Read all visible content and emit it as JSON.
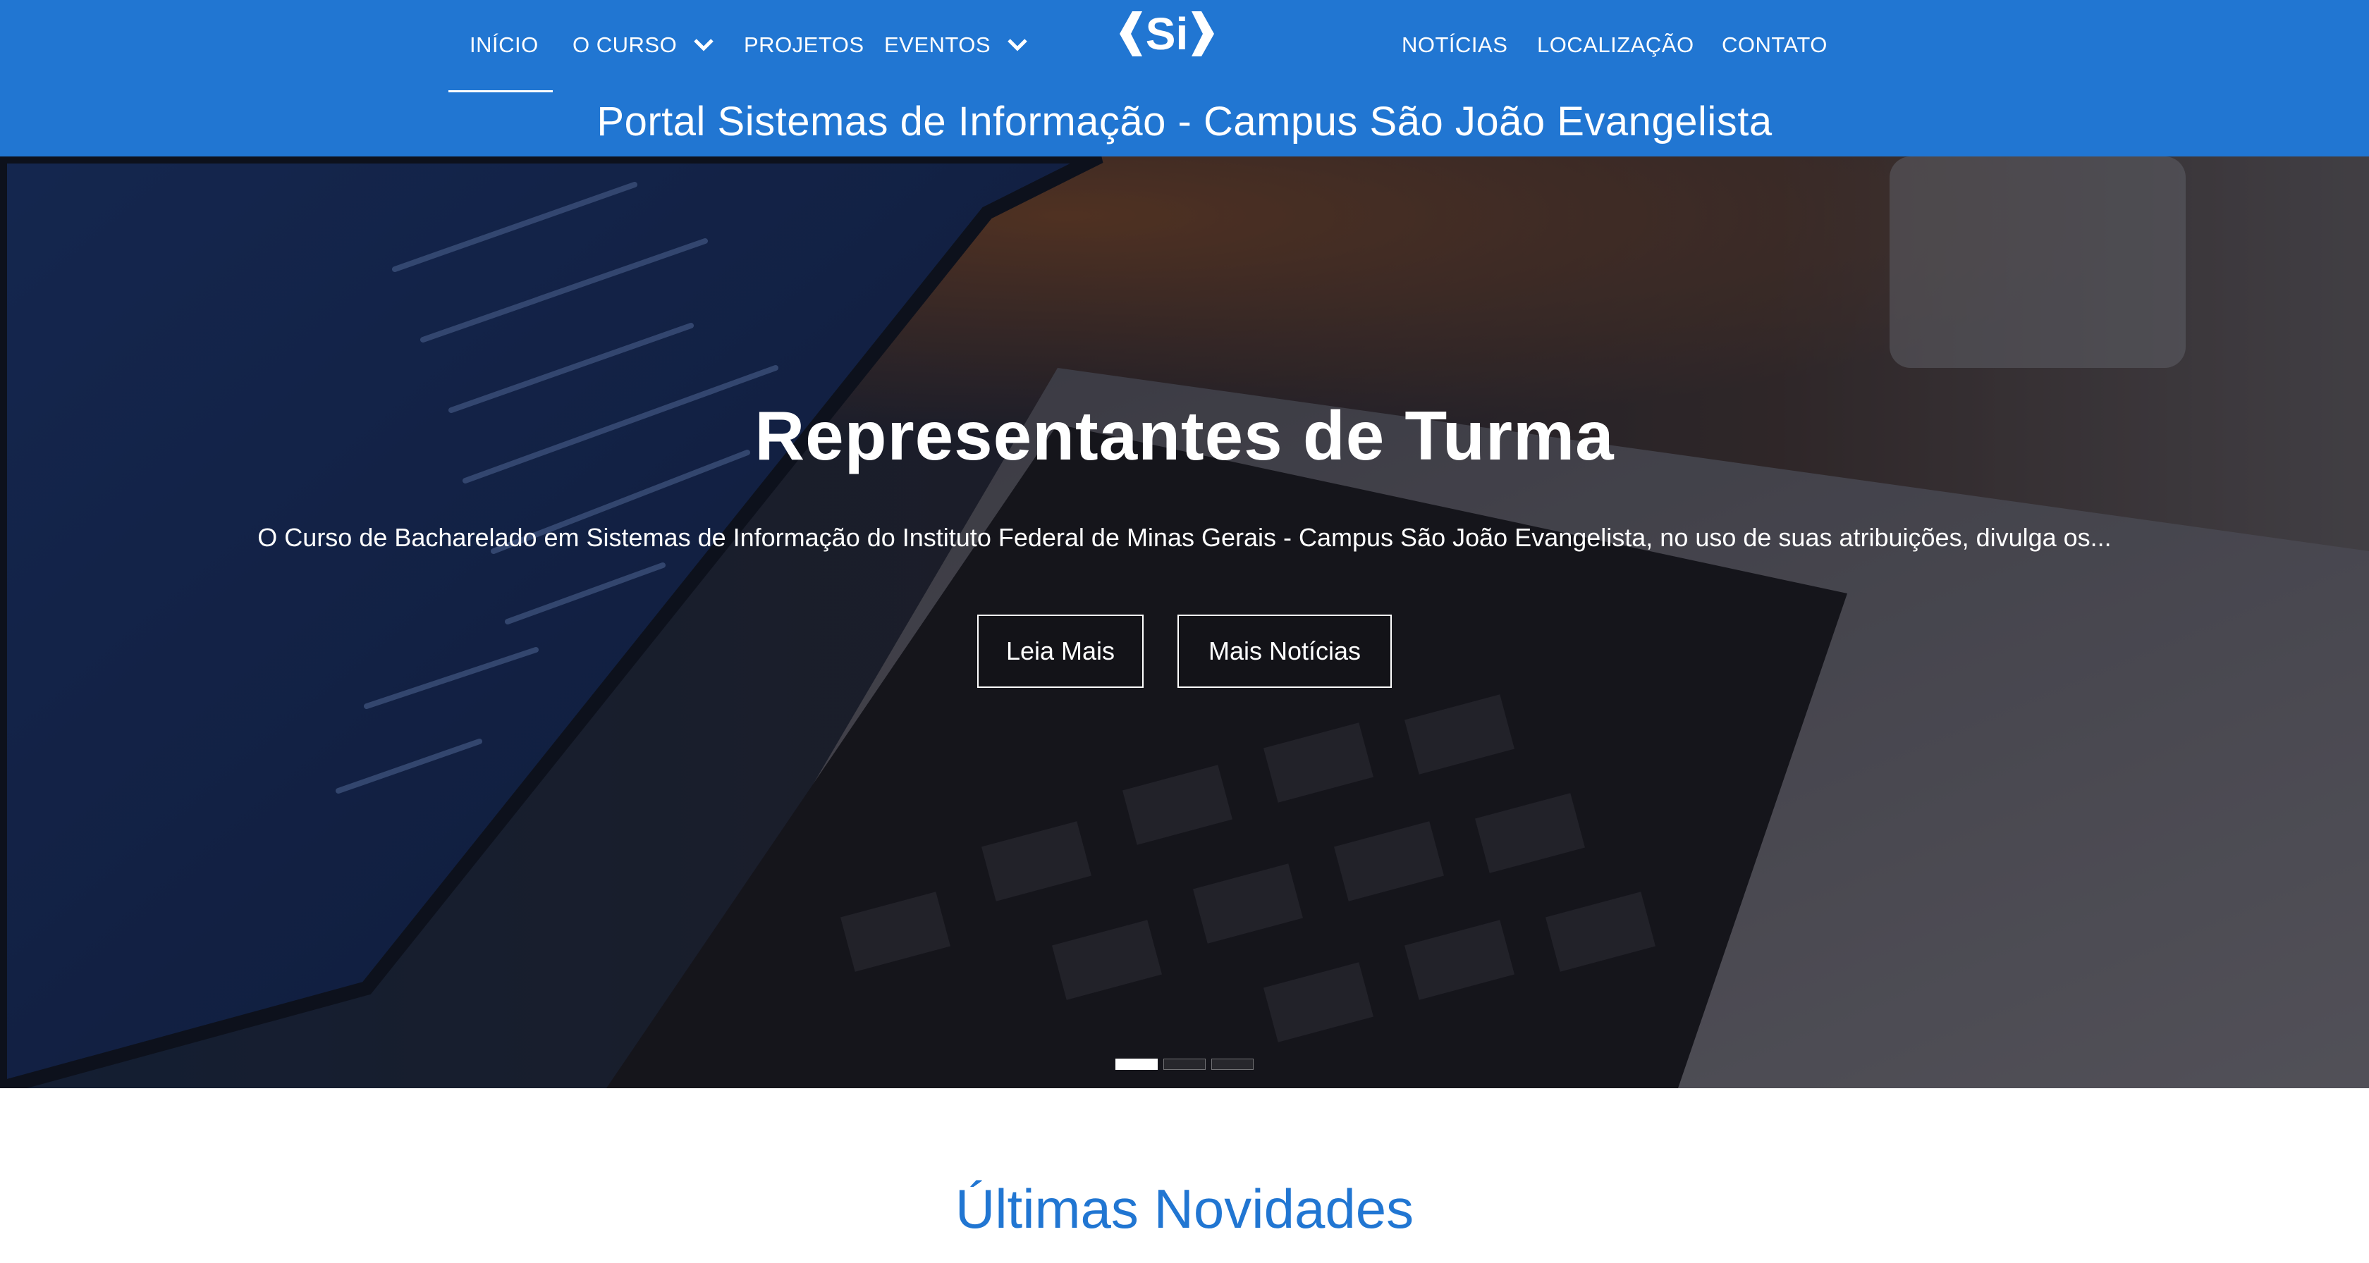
{
  "nav": {
    "left_items": [
      {
        "label": "INÍCIO"
      },
      {
        "label": "O CURSO"
      },
      {
        "label": "PROJETOS"
      },
      {
        "label": "EVENTOS"
      }
    ],
    "right_items": [
      {
        "label": "NOTÍCIAS"
      },
      {
        "label": "LOCALIZAÇÃO"
      },
      {
        "label": "CONTATO"
      }
    ],
    "logo_text": "Si"
  },
  "site_title": "Portal Sistemas de Informação - Campus São João Evangelista",
  "hero": {
    "title": "Representantes de Turma",
    "description": "O Curso de Bacharelado em Sistemas de Informação do Instituto Federal de Minas Gerais - Campus São João Evangelista, no uso de suas atribuições, divulga os...",
    "read_more_label": "Leia Mais",
    "more_news_label": "Mais Notícias",
    "slide_count": 3,
    "active_slide": 1
  },
  "section": {
    "title": "Últimas Novidades"
  },
  "colors": {
    "brand_blue": "#2176d2",
    "white": "#ffffff"
  }
}
